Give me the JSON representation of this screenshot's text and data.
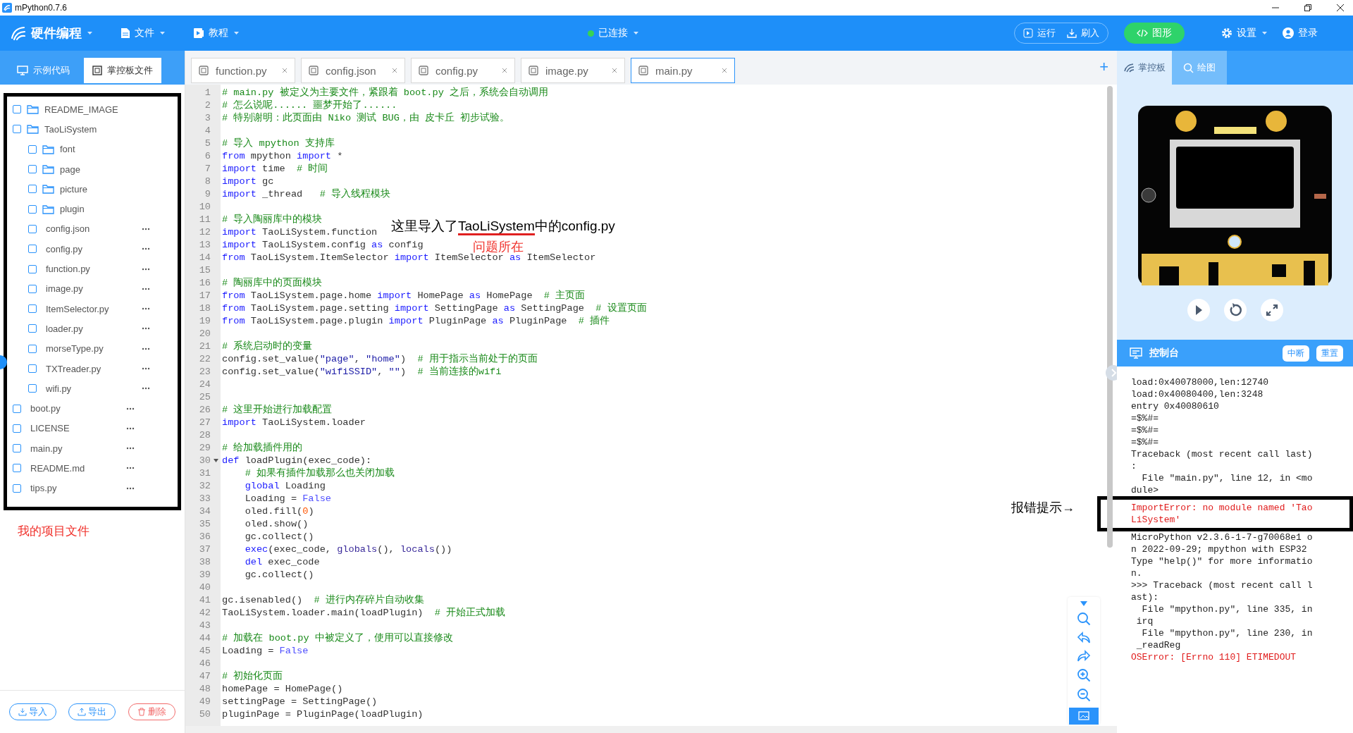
{
  "window": {
    "title": "mPython0.7.6"
  },
  "toolbar": {
    "brand": "硬件编程",
    "menus": [
      "文件",
      "教程"
    ],
    "status": {
      "label": "已连接",
      "connected": true
    },
    "run_group": [
      "运行",
      "刷入"
    ],
    "graph": {
      "label": "图形",
      "selected": true
    },
    "settings": "设置",
    "login": "登录"
  },
  "left_tabs": [
    {
      "label": "示例代码",
      "selected": false
    },
    {
      "label": "掌控板文件",
      "selected": true
    }
  ],
  "file_panel": {
    "tree": [
      {
        "name": "README_IMAGE",
        "kind": "folder",
        "checked": false
      },
      {
        "name": "TaoLiSystem",
        "kind": "folder",
        "checked": false,
        "children": [
          {
            "name": "font",
            "kind": "folder",
            "checked": false
          },
          {
            "name": "page",
            "kind": "folder",
            "checked": false
          },
          {
            "name": "picture",
            "kind": "folder",
            "checked": false
          },
          {
            "name": "plugin",
            "kind": "folder",
            "checked": false
          },
          {
            "name": "config.json",
            "kind": "file",
            "checked": false
          },
          {
            "name": "config.py",
            "kind": "file",
            "checked": false
          },
          {
            "name": "function.py",
            "kind": "file",
            "checked": false
          },
          {
            "name": "image.py",
            "kind": "file",
            "checked": false
          },
          {
            "name": "ItemSelector.py",
            "kind": "file",
            "checked": false
          },
          {
            "name": "loader.py",
            "kind": "file",
            "checked": false
          },
          {
            "name": "morseType.py",
            "kind": "file",
            "checked": false
          },
          {
            "name": "TXTreader.py",
            "kind": "file",
            "checked": false
          },
          {
            "name": "wifi.py",
            "kind": "file",
            "checked": false
          }
        ]
      },
      {
        "name": "boot.py",
        "kind": "file",
        "checked": false
      },
      {
        "name": "LICENSE",
        "kind": "file",
        "checked": false
      },
      {
        "name": "main.py",
        "kind": "file",
        "checked": false
      },
      {
        "name": "README.md",
        "kind": "file",
        "checked": false
      },
      {
        "name": "tips.py",
        "kind": "file",
        "checked": false
      }
    ],
    "note": "我的项目文件",
    "buttons": [
      {
        "label": "导入",
        "kind": "import"
      },
      {
        "label": "导出",
        "kind": "export"
      },
      {
        "label": "删除",
        "kind": "delete"
      }
    ]
  },
  "editor_tabs": [
    {
      "label": "function.py",
      "selected": false
    },
    {
      "label": "config.json",
      "selected": false
    },
    {
      "label": "config.py",
      "selected": false
    },
    {
      "label": "image.py",
      "selected": false
    },
    {
      "label": "main.py",
      "selected": true
    }
  ],
  "new_tab": "+",
  "editor": {
    "lines": [
      {
        "number": "1",
        "tokens": [
          {
            "kind": "comment",
            "text": "# main.py 被定义为主要文件，紧跟着 boot.py 之后，系统会自动调用"
          }
        ]
      },
      {
        "number": "2",
        "tokens": [
          {
            "kind": "comment",
            "text": "# 怎么说呢...... 噩梦开始了......"
          }
        ]
      },
      {
        "number": "3",
        "tokens": [
          {
            "kind": "comment",
            "text": "# 特别谢明：此页面由 Niko 测试 BUG，由 皮卡丘 初步试验。"
          }
        ]
      },
      {
        "number": "4"
      },
      {
        "number": "5",
        "tokens": [
          {
            "kind": "comment",
            "text": "# 导入 mpython 支持库"
          }
        ]
      },
      {
        "number": "6",
        "tokens": [
          {
            "kind": "keyword",
            "text": "from"
          },
          {
            "kind": "plain",
            "text": " mpython "
          },
          {
            "kind": "keyword",
            "text": "import"
          },
          {
            "kind": "plain",
            "text": " *"
          }
        ]
      },
      {
        "number": "7",
        "tokens": [
          {
            "kind": "keyword",
            "text": "import"
          },
          {
            "kind": "plain",
            "text": " time  "
          },
          {
            "kind": "comment",
            "text": "# 时间"
          }
        ]
      },
      {
        "number": "8",
        "tokens": [
          {
            "kind": "keyword",
            "text": "import"
          },
          {
            "kind": "plain",
            "text": " gc"
          }
        ]
      },
      {
        "number": "9",
        "tokens": [
          {
            "kind": "keyword",
            "text": "import"
          },
          {
            "kind": "plain",
            "text": " _thread   "
          },
          {
            "kind": "comment",
            "text": "# 导入线程模块"
          }
        ]
      },
      {
        "number": "10"
      },
      {
        "number": "11",
        "tokens": [
          {
            "kind": "comment",
            "text": "# 导入陶丽库中的模块"
          }
        ]
      },
      {
        "number": "12",
        "tokens": [
          {
            "kind": "keyword",
            "text": "import"
          },
          {
            "kind": "plain",
            "text": " TaoLiSystem.function"
          }
        ]
      },
      {
        "number": "13",
        "tokens": [
          {
            "kind": "keyword",
            "text": "import"
          },
          {
            "kind": "plain",
            "text": " TaoLiSystem.config "
          },
          {
            "kind": "keyword",
            "text": "as"
          },
          {
            "kind": "plain",
            "text": " config"
          }
        ]
      },
      {
        "number": "14",
        "tokens": [
          {
            "kind": "keyword",
            "text": "from"
          },
          {
            "kind": "plain",
            "text": " TaoLiSystem.ItemSelector "
          },
          {
            "kind": "keyword",
            "text": "import"
          },
          {
            "kind": "plain",
            "text": " ItemSelector "
          },
          {
            "kind": "keyword",
            "text": "as"
          },
          {
            "kind": "plain",
            "text": " ItemSelector"
          }
        ]
      },
      {
        "number": "15"
      },
      {
        "number": "16",
        "tokens": [
          {
            "kind": "comment",
            "text": "# 陶丽库中的页面模块"
          }
        ]
      },
      {
        "number": "17",
        "tokens": [
          {
            "kind": "keyword",
            "text": "from"
          },
          {
            "kind": "plain",
            "text": " TaoLiSystem.page.home "
          },
          {
            "kind": "keyword",
            "text": "import"
          },
          {
            "kind": "plain",
            "text": " HomePage "
          },
          {
            "kind": "keyword",
            "text": "as"
          },
          {
            "kind": "plain",
            "text": " HomePage  "
          },
          {
            "kind": "comment",
            "text": "# 主页面"
          }
        ]
      },
      {
        "number": "18",
        "tokens": [
          {
            "kind": "keyword",
            "text": "from"
          },
          {
            "kind": "plain",
            "text": " TaoLiSystem.page.setting "
          },
          {
            "kind": "keyword",
            "text": "import"
          },
          {
            "kind": "plain",
            "text": " SettingPage "
          },
          {
            "kind": "keyword",
            "text": "as"
          },
          {
            "kind": "plain",
            "text": " SettingPage  "
          },
          {
            "kind": "comment",
            "text": "# 设置页面"
          }
        ]
      },
      {
        "number": "19",
        "tokens": [
          {
            "kind": "keyword",
            "text": "from"
          },
          {
            "kind": "plain",
            "text": " TaoLiSystem.page.plugin "
          },
          {
            "kind": "keyword",
            "text": "import"
          },
          {
            "kind": "plain",
            "text": " PluginPage "
          },
          {
            "kind": "keyword",
            "text": "as"
          },
          {
            "kind": "plain",
            "text": " PluginPage  "
          },
          {
            "kind": "comment",
            "text": "# 插件"
          }
        ]
      },
      {
        "number": "20"
      },
      {
        "number": "21",
        "tokens": [
          {
            "kind": "comment",
            "text": "# 系统启动时的变量"
          }
        ]
      },
      {
        "number": "22",
        "tokens": [
          {
            "kind": "plain",
            "text": "config.set_value("
          },
          {
            "kind": "string",
            "text": "\"page\""
          },
          {
            "kind": "plain",
            "text": ", "
          },
          {
            "kind": "string",
            "text": "\"home\""
          },
          {
            "kind": "plain",
            "text": ")  "
          },
          {
            "kind": "comment",
            "text": "# 用于指示当前处于的页面"
          }
        ]
      },
      {
        "number": "23",
        "tokens": [
          {
            "kind": "plain",
            "text": "config.set_value("
          },
          {
            "kind": "string",
            "text": "\"wifiSSID\""
          },
          {
            "kind": "plain",
            "text": ", "
          },
          {
            "kind": "string",
            "text": "\"\""
          },
          {
            "kind": "plain",
            "text": ")  "
          },
          {
            "kind": "comment",
            "text": "# 当前连接的wifi"
          }
        ]
      },
      {
        "number": "24"
      },
      {
        "number": "25"
      },
      {
        "number": "26",
        "tokens": [
          {
            "kind": "comment",
            "text": "# 这里开始进行加载配置"
          }
        ]
      },
      {
        "number": "27",
        "tokens": [
          {
            "kind": "keyword",
            "text": "import"
          },
          {
            "kind": "plain",
            "text": " TaoLiSystem.loader"
          }
        ]
      },
      {
        "number": "28"
      },
      {
        "number": "29",
        "tokens": [
          {
            "kind": "comment",
            "text": "# 给加载插件用的"
          }
        ]
      },
      {
        "number": "30",
        "foldable": true,
        "tokens": [
          {
            "kind": "keyword",
            "text": "def"
          },
          {
            "kind": "plain",
            "text": " loadPlugin(exec_code):"
          }
        ]
      },
      {
        "number": "31",
        "indented": true,
        "tokens": [
          {
            "kind": "comment",
            "text": "# 如果有插件加载那么也关闭加载"
          }
        ]
      },
      {
        "number": "32",
        "indented": true,
        "tokens": [
          {
            "kind": "keyword",
            "text": "global"
          },
          {
            "kind": "plain",
            "text": " Loading"
          }
        ]
      },
      {
        "number": "33",
        "indented": true,
        "tokens": [
          {
            "kind": "plain",
            "text": "Loading = "
          },
          {
            "kind": "constant",
            "text": "False"
          }
        ]
      },
      {
        "number": "34",
        "indented": true,
        "tokens": [
          {
            "kind": "plain",
            "text": "oled.fill("
          },
          {
            "kind": "number",
            "text": "0"
          },
          {
            "kind": "plain",
            "text": ")"
          }
        ]
      },
      {
        "number": "35",
        "indented": true,
        "tokens": [
          {
            "kind": "plain",
            "text": "oled.show()"
          }
        ]
      },
      {
        "number": "36",
        "indented": true,
        "tokens": [
          {
            "kind": "plain",
            "text": "gc.collect()"
          }
        ]
      },
      {
        "number": "37",
        "indented": true,
        "tokens": [
          {
            "kind": "keyword",
            "text": "exec"
          },
          {
            "kind": "plain",
            "text": "(exec_code, "
          },
          {
            "kind": "builtin",
            "text": "globals"
          },
          {
            "kind": "plain",
            "text": "(), "
          },
          {
            "kind": "builtin",
            "text": "locals"
          },
          {
            "kind": "plain",
            "text": "())"
          }
        ]
      },
      {
        "number": "38",
        "indented": true,
        "tokens": [
          {
            "kind": "keyword",
            "text": "del"
          },
          {
            "kind": "plain",
            "text": " exec_code"
          }
        ]
      },
      {
        "number": "39",
        "indented": true,
        "tokens": [
          {
            "kind": "plain",
            "text": "gc.collect()"
          }
        ]
      },
      {
        "number": "40"
      },
      {
        "number": "41",
        "tokens": [
          {
            "kind": "plain",
            "text": "gc.isenabled()  "
          },
          {
            "kind": "comment",
            "text": "# 进行内存碎片自动收集"
          }
        ]
      },
      {
        "number": "42",
        "tokens": [
          {
            "kind": "plain",
            "text": "TaoLiSystem.loader.main(loadPlugin)  "
          },
          {
            "kind": "comment",
            "text": "# 开始正式加载"
          }
        ]
      },
      {
        "number": "43"
      },
      {
        "number": "44",
        "tokens": [
          {
            "kind": "comment",
            "text": "# 加载在 boot.py 中被定义了，使用可以直接修改"
          }
        ]
      },
      {
        "number": "45",
        "tokens": [
          {
            "kind": "plain",
            "text": "Loading = "
          },
          {
            "kind": "constant",
            "text": "False"
          }
        ]
      },
      {
        "number": "46"
      },
      {
        "number": "47",
        "tokens": [
          {
            "kind": "comment",
            "text": "# 初始化页面"
          }
        ]
      },
      {
        "number": "48",
        "tokens": [
          {
            "kind": "plain",
            "text": "homePage = HomePage()"
          }
        ]
      },
      {
        "number": "49",
        "tokens": [
          {
            "kind": "plain",
            "text": "settingPage = SettingPage()"
          }
        ]
      },
      {
        "number": "50",
        "tokens": [
          {
            "kind": "plain",
            "text": "pluginPage = PluginPage(loadPlugin)"
          }
        ]
      }
    ],
    "note": {
      "before": "这里导入了",
      "underlined": "TaoLiSystem",
      "after": "中的config.py"
    },
    "problem_note": "问题所在"
  },
  "right_tabs": [
    {
      "label": "掌控板",
      "selected": true
    },
    {
      "label": "绘图",
      "selected": false
    }
  ],
  "console": {
    "title": "控制台",
    "buttons": [
      "中断",
      "重置"
    ],
    "annotation": "报错提示→",
    "blocks": [
      {
        "framed": false,
        "rows": [
          {
            "text": "load:0x40078000,len:12740",
            "kind": "output"
          },
          {
            "text": "load:0x40080400,len:3248",
            "kind": "output"
          },
          {
            "text": "entry 0x40080610",
            "kind": "output"
          },
          {
            "text": "=$%#=",
            "kind": "output"
          },
          {
            "text": "=$%#=",
            "kind": "output"
          },
          {
            "text": "=$%#=",
            "kind": "output"
          },
          {
            "text": "Traceback (most recent call last)",
            "kind": "output"
          },
          {
            "text": ":",
            "kind": "output"
          },
          {
            "text": "  File \"main.py\", line 12, in <mo",
            "kind": "output"
          },
          {
            "text": "dule>",
            "kind": "output"
          }
        ]
      },
      {
        "framed": true,
        "rows": [
          {
            "text": "ImportError: no module named 'Tao",
            "kind": "error"
          },
          {
            "text": "LiSystem'",
            "kind": "error"
          }
        ]
      },
      {
        "framed": false,
        "rows": [
          {
            "text": "MicroPython v2.3.6-1-7-g70068e1 o",
            "kind": "output"
          },
          {
            "text": "n 2022-09-29; mpython with ESP32",
            "kind": "output"
          },
          {
            "text": "Type \"help()\" for more informatio",
            "kind": "output"
          },
          {
            "text": "n.",
            "kind": "output"
          },
          {
            "text": ">>> Traceback (most recent call l",
            "kind": "output"
          },
          {
            "text": "ast):",
            "kind": "output"
          },
          {
            "text": "  File \"mpython.py\", line 335, in",
            "kind": "output"
          },
          {
            "text": " irq",
            "kind": "output"
          },
          {
            "text": "  File \"mpython.py\", line 230, in",
            "kind": "output"
          },
          {
            "text": " _readReg",
            "kind": "output"
          },
          {
            "text": "OSError: [Errno 110] ETIMEDOUT",
            "kind": "error"
          }
        ]
      }
    ]
  }
}
